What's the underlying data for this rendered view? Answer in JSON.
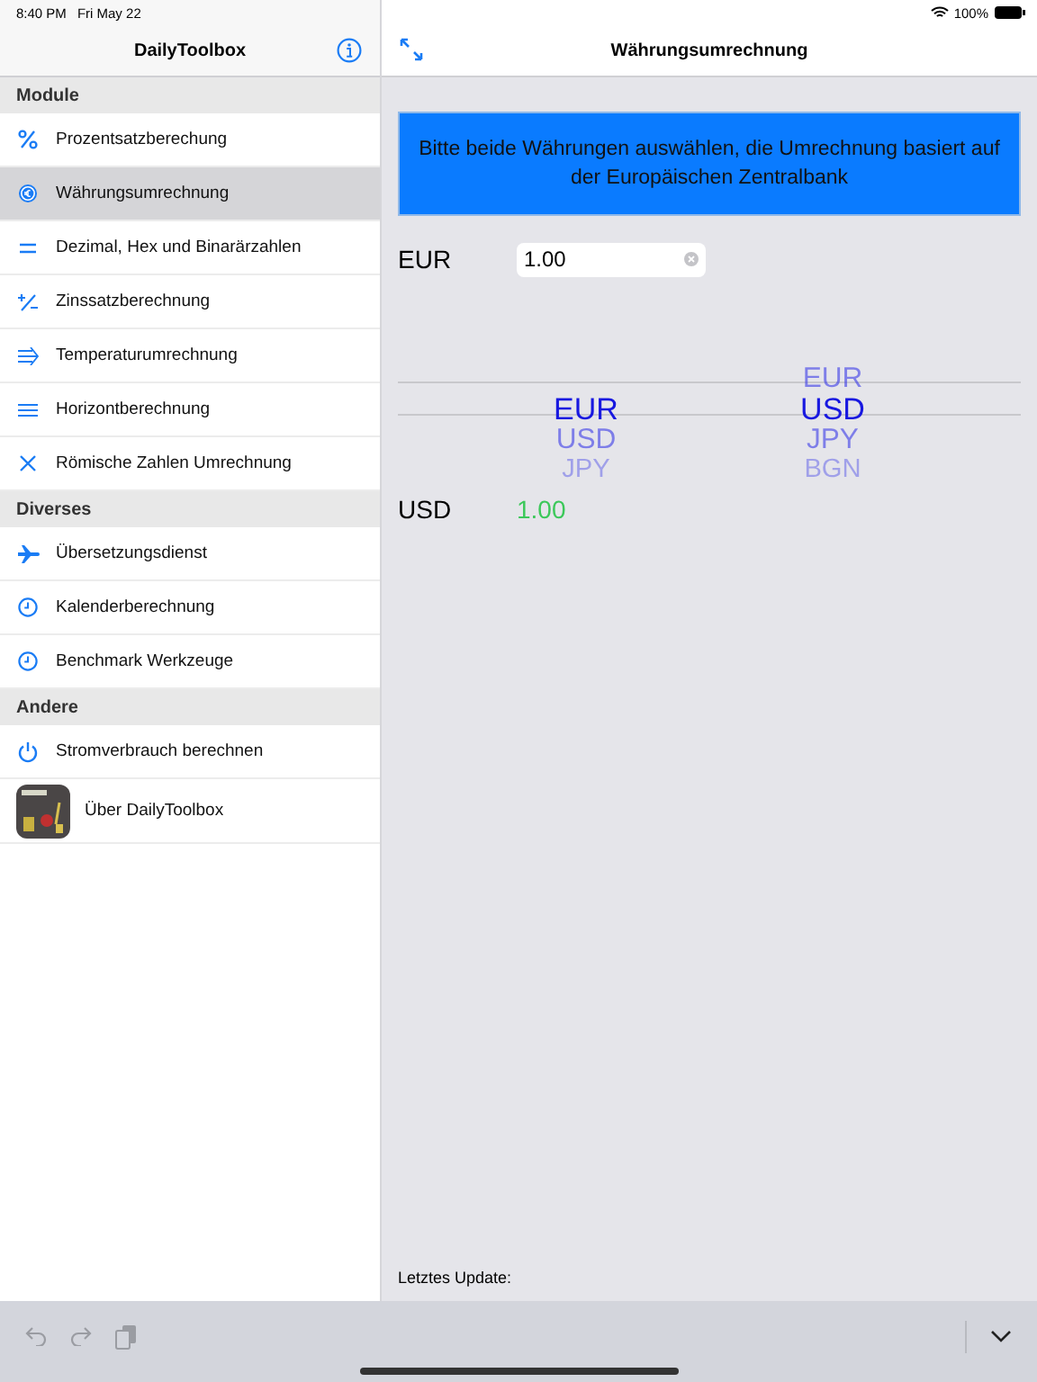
{
  "status_bar": {
    "time": "8:40 PM",
    "date": "Fri May 22",
    "battery": "100%"
  },
  "sidebar": {
    "title": "DailyToolbox",
    "sections": [
      {
        "header": "Module",
        "items": [
          {
            "label": "Prozentsatzberechung",
            "kind": "percent",
            "selected": false
          },
          {
            "label": "Währungsumrechnung",
            "kind": "currency",
            "selected": true
          },
          {
            "label": "Dezimal, Hex und Binarärzahlen",
            "kind": "equals",
            "selected": false
          },
          {
            "label": "Zinssatzberechnung",
            "kind": "plusminus",
            "selected": false
          },
          {
            "label": "Temperaturumrechnung",
            "kind": "wind",
            "selected": false
          },
          {
            "label": "Horizontberechnung",
            "kind": "lines",
            "selected": false
          },
          {
            "label": "Römische Zahlen Umrechnung",
            "kind": "cross",
            "selected": false
          }
        ]
      },
      {
        "header": "Diverses",
        "items": [
          {
            "label": "Übersetzungsdienst",
            "kind": "plane",
            "selected": false
          },
          {
            "label": "Kalenderberechnung",
            "kind": "clock",
            "selected": false
          },
          {
            "label": "Benchmark Werkzeuge",
            "kind": "clock",
            "selected": false
          }
        ]
      },
      {
        "header": "Andere",
        "items": [
          {
            "label": "Stromverbrauch berechnen",
            "kind": "power",
            "selected": false
          },
          {
            "label": "Über DailyToolbox",
            "kind": "app",
            "selected": false
          }
        ]
      }
    ]
  },
  "detail": {
    "title": "Währungsumrechnung",
    "banner": "Bitte beide Währungen auswählen, die Umrechnung basiert auf der Europäischen Zentralbank",
    "from_label": "EUR",
    "amount": "1.00",
    "pickers": [
      [
        {
          "label": "EUR",
          "selected": true
        },
        {
          "label": "USD",
          "selected": false
        },
        {
          "label": "JPY",
          "selected": false
        }
      ],
      [
        {
          "label": "EUR",
          "selected": false
        },
        {
          "label": "USD",
          "selected": true
        },
        {
          "label": "JPY",
          "selected": false
        },
        {
          "label": "BGN",
          "selected": false
        }
      ]
    ],
    "to_label": "USD",
    "result": "1.00",
    "last_update": "Letztes Update:"
  }
}
